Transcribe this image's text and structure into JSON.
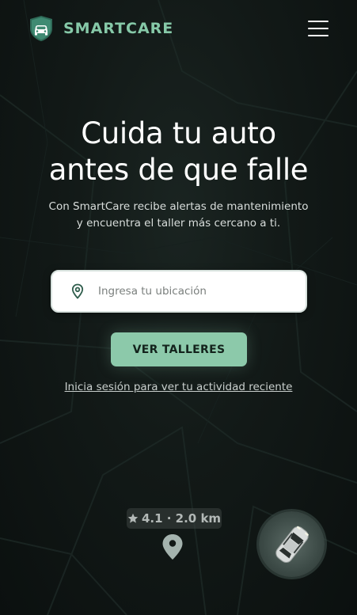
{
  "brand": {
    "name": "SMARTCARE",
    "accent_color": "#86c9a8",
    "logo_icon": "car-shield-icon"
  },
  "header": {
    "menu_icon": "hamburger-menu-icon"
  },
  "hero": {
    "title_line1": "Cuida tu auto",
    "title_line2": "antes de que falle",
    "subtitle_line1": "Con SmartCare recibe alertas de mantenimiento",
    "subtitle_line2": "y encuentra el taller más cercano a ti."
  },
  "search": {
    "placeholder": "Ingresa tu ubicación",
    "value": "",
    "icon": "location-pin-icon"
  },
  "cta": {
    "label": "VER TALLERES",
    "color": "#8cc9aa"
  },
  "login_link": {
    "label": "Inicia sesión para ver tu actividad reciente"
  },
  "map": {
    "rating_text": "4.1 · 2.0 km",
    "rating_icon": "star-icon",
    "pin_icon": "map-pin-icon",
    "car_icon": "car-top-view-icon"
  }
}
